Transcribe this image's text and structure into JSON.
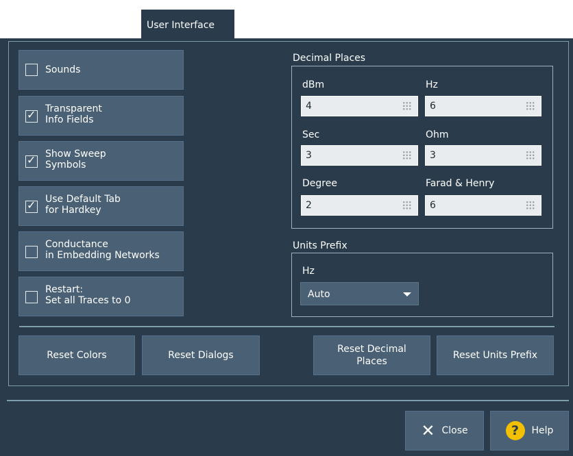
{
  "tab": {
    "label": "User Interface"
  },
  "checkboxes": [
    {
      "label": "Sounds",
      "checked": false
    },
    {
      "label": "Transparent\nInfo Fields",
      "checked": true
    },
    {
      "label": "Show Sweep\n Symbols",
      "checked": true
    },
    {
      "label": "Use Default Tab\nfor Hardkey",
      "checked": true
    },
    {
      "label": "Conductance\nin Embedding Networks",
      "checked": false
    },
    {
      "label": "Restart:\nSet all Traces to 0",
      "checked": false
    }
  ],
  "decimal_places": {
    "title": "Decimal Places",
    "fields": [
      {
        "label": "dBm",
        "value": "4"
      },
      {
        "label": "Hz",
        "value": "6"
      },
      {
        "label": "Sec",
        "value": "3"
      },
      {
        "label": "Ohm",
        "value": "3"
      },
      {
        "label": "Degree",
        "value": "2"
      },
      {
        "label": "Farad & Henry",
        "value": "6"
      }
    ]
  },
  "units_prefix": {
    "title": "Units Prefix",
    "hz_label": "Hz",
    "hz_value": "Auto"
  },
  "buttons": {
    "reset_colors": "Reset Colors",
    "reset_dialogs": "Reset Dialogs",
    "reset_decimal_places": "Reset Decimal\nPlaces",
    "reset_units_prefix": "Reset Units Prefix"
  },
  "footer": {
    "close": "Close",
    "help": "Help"
  }
}
